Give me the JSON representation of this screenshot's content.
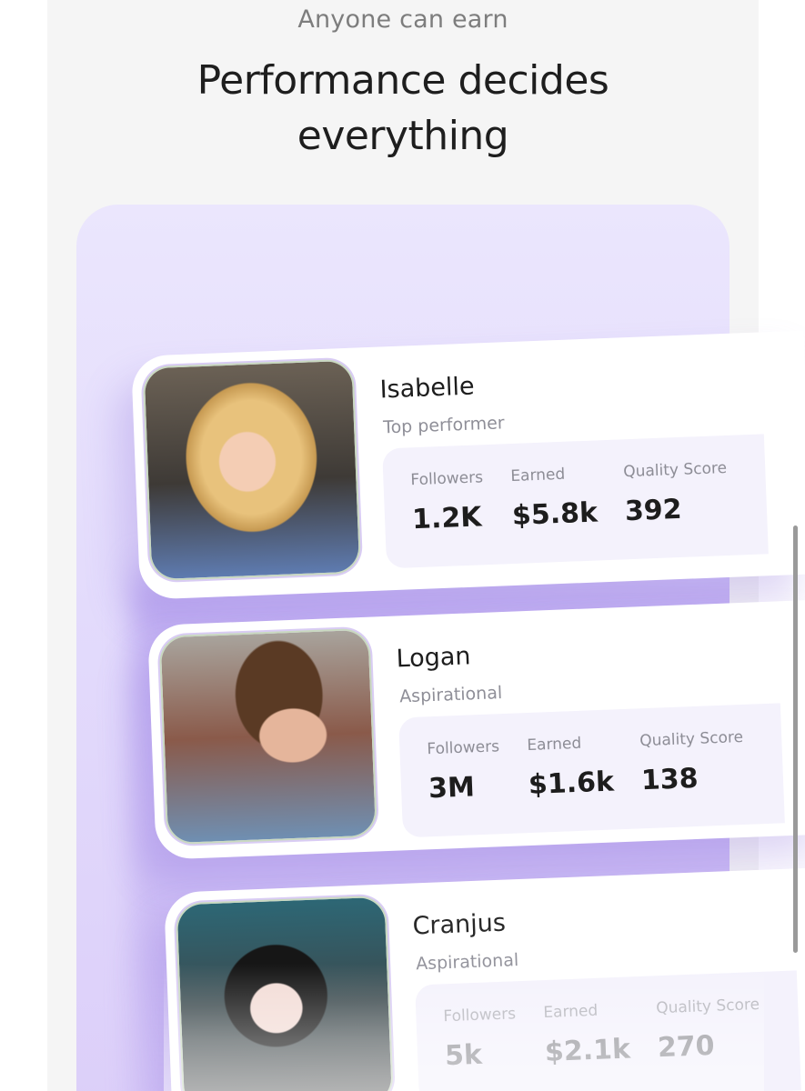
{
  "header": {
    "eyebrow": "Anyone can earn",
    "headline_line1": "Performance decides",
    "headline_line2": "everything"
  },
  "creators": [
    {
      "name": "Isabelle",
      "role": "Top performer",
      "stats": [
        {
          "label": "Followers",
          "value": "1.2K"
        },
        {
          "label": "Earned",
          "value": "$5.8k"
        },
        {
          "label": "Quality Score",
          "value": "392"
        }
      ]
    },
    {
      "name": "Logan",
      "role": "Aspirational",
      "stats": [
        {
          "label": "Followers",
          "value": "3M"
        },
        {
          "label": "Earned",
          "value": "$1.6k"
        },
        {
          "label": "Quality Score",
          "value": "138"
        }
      ]
    },
    {
      "name": "Cranjus",
      "role": "Aspirational",
      "stats": [
        {
          "label": "Followers",
          "value": "5k"
        },
        {
          "label": "Earned",
          "value": "$2.1k"
        },
        {
          "label": "Quality Score",
          "value": "270"
        }
      ]
    }
  ],
  "colors": {
    "stage": "#e3dbfc",
    "accent_purple": "#ab93ec",
    "stat_panel": "#f4f2fc",
    "text_dark": "#1d1d1d",
    "text_muted": "#8f8f98"
  }
}
